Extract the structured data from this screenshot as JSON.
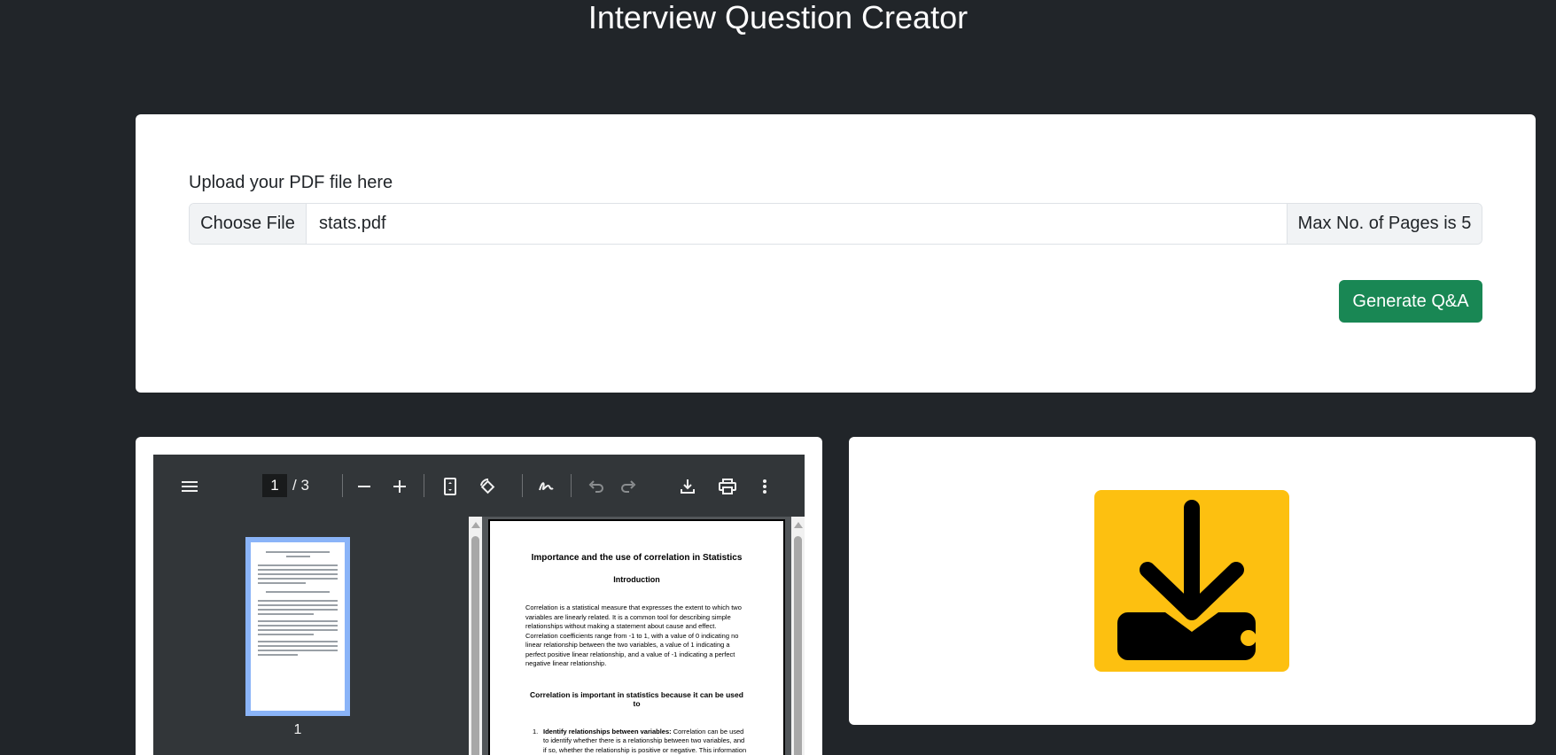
{
  "header": {
    "title": "Interview Question Creator"
  },
  "upload": {
    "label": "Upload your PDF file here",
    "choose_button": "Choose File",
    "file_name": "stats.pdf",
    "max_pages_note": "Max No. of Pages is 5",
    "generate_button": "Generate Q&A"
  },
  "pdf_viewer": {
    "current_page": "1",
    "page_total": "/ 3",
    "toolbar_icons": [
      "menu-icon",
      "zoom-out-icon",
      "zoom-in-icon",
      "fit-page-icon",
      "rotate-icon",
      "annotate-icon",
      "undo-icon",
      "redo-icon",
      "download-icon",
      "print-icon",
      "more-icon"
    ],
    "thumbnail_label": "1",
    "document": {
      "title": "Importance and the use of correlation in Statistics",
      "section": "Introduction",
      "paragraph": "Correlation is a statistical measure that expresses the extent to which two variables are linearly related. It is a common tool for describing simple relationships without making a statement about cause and effect. Correlation coefficients range from -1 to 1, with a value of 0 indicating no linear relationship between the two variables, a value of 1 indicating a perfect positive linear relationship, and a value of -1 indicating a perfect negative linear relationship.",
      "subheading": "Correlation is important in statistics because it can be used to",
      "list_item_number": "1.",
      "list_item_bold": "Identify relationships between variables:",
      "list_item_text": " Correlation can be used to identify whether there is a relationship between two variables, and if so, whether the relationship is positive or negative. This information can be useful for understanding the"
    }
  },
  "result_panel": {
    "icon": "download-icon"
  },
  "colors": {
    "background": "#212529",
    "card": "#ffffff",
    "generate_button": "#198754",
    "download_tile": "#fdc010"
  }
}
